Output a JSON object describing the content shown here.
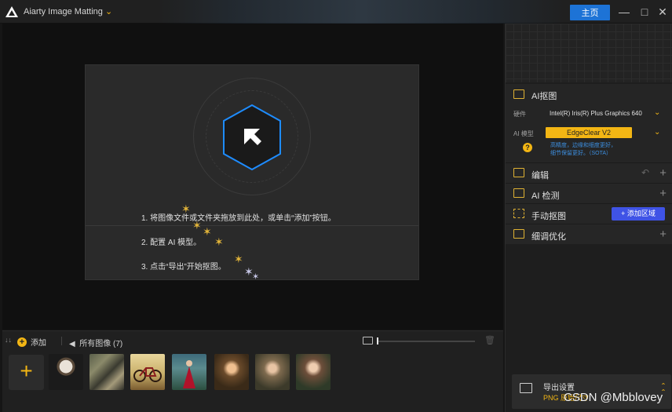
{
  "window": {
    "title": "Aiarty Image Matting",
    "home_button": "主页",
    "minimize_icon": "minimize-icon",
    "maximize_icon": "maximize-icon",
    "close_icon": "close-icon"
  },
  "drop_area": {
    "step1": "1. 将图像文件或文件夹拖放到此处，或单击“添加”按钮。",
    "step2": "2. 配置 AI 模型。",
    "step3": "3. 点击“导出”开始抠图。"
  },
  "tray": {
    "add_label": "添加",
    "all_images_label": "所有图像 (7)",
    "thumbnail_count": 7
  },
  "right_panel": {
    "ai_section": {
      "title": "AI抠图",
      "hardware_label": "硬件",
      "hardware_value": "Intel(R) Iris(R) Plus Graphics 640",
      "model_label": "AI 模型",
      "model_value": "EdgeClear  V2",
      "note_line1": "高精度，边缘和细度更好，",
      "note_line2": "细节保留更好。（SOTA）"
    },
    "rows": {
      "edit": "编辑",
      "detect": "AI 检测",
      "manual": "手动抠图",
      "add_region": "+ 添加区域",
      "refine": "细调优化"
    },
    "export": {
      "title": "导出设置",
      "format": "PNG  原始尺寸"
    }
  },
  "watermark": "CSDN @Mbblovey",
  "colors": {
    "accent": "#f3b614",
    "home_button": "#1d73d6",
    "add_region": "#3f53e6",
    "hex_blue": "#1e8cff"
  }
}
